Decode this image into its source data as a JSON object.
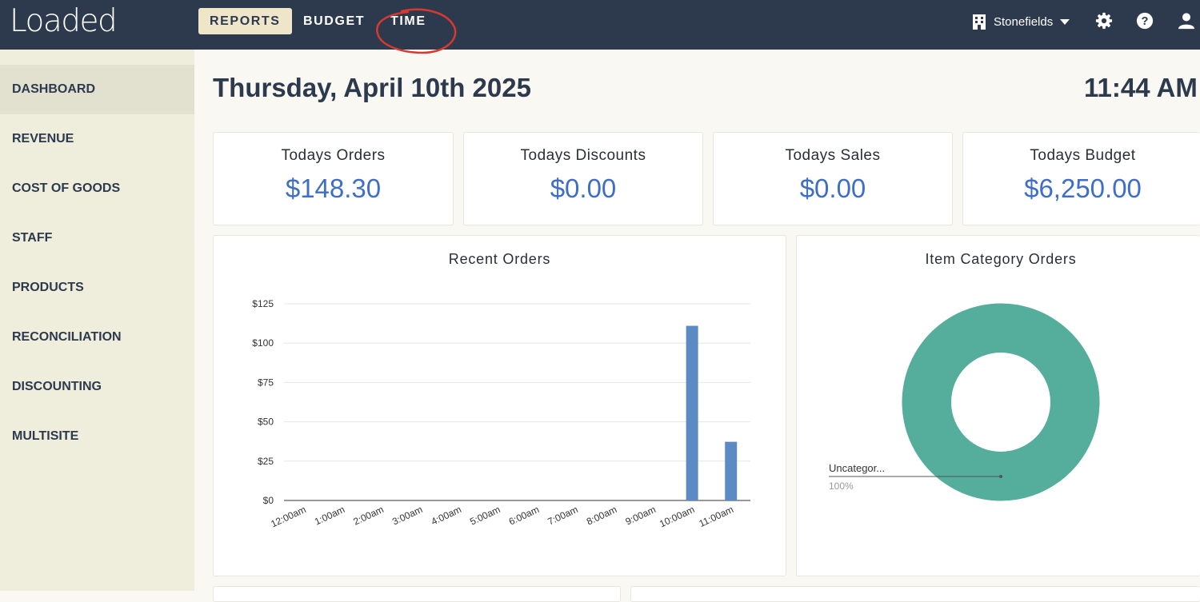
{
  "app": {
    "logo": "Loaded"
  },
  "nav": {
    "tabs": [
      {
        "label": "REPORTS",
        "active": true
      },
      {
        "label": "BUDGET",
        "active": false
      },
      {
        "label": "TIME",
        "active": false
      }
    ],
    "site": "Stonefields"
  },
  "sidebar": {
    "items": [
      {
        "label": "DASHBOARD",
        "active": true
      },
      {
        "label": "REVENUE",
        "active": false
      },
      {
        "label": "COST OF GOODS",
        "active": false
      },
      {
        "label": "STAFF",
        "active": false
      },
      {
        "label": "PRODUCTS",
        "active": false
      },
      {
        "label": "RECONCILIATION",
        "active": false
      },
      {
        "label": "DISCOUNTING",
        "active": false
      },
      {
        "label": "MULTISITE",
        "active": false
      }
    ]
  },
  "header": {
    "date": "Thursday, April 10th 2025",
    "time": "11:44 AM"
  },
  "stats": [
    {
      "title": "Todays Orders",
      "value": "$148.30"
    },
    {
      "title": "Todays Discounts",
      "value": "$0.00"
    },
    {
      "title": "Todays Sales",
      "value": "$0.00"
    },
    {
      "title": "Todays Budget",
      "value": "$6,250.00"
    }
  ],
  "colors": {
    "accent": "#3e6ec7",
    "bar": "#5b8bc2",
    "donut": "#55ad9b",
    "topbar": "#2d3a4e"
  },
  "icons": [
    "building-icon",
    "gear-icon",
    "help-icon",
    "user-icon"
  ],
  "chart_data": [
    {
      "type": "bar",
      "title": "Recent Orders",
      "categories": [
        "12:00am",
        "1:00am",
        "2:00am",
        "3:00am",
        "4:00am",
        "5:00am",
        "6:00am",
        "7:00am",
        "8:00am",
        "9:00am",
        "10:00am",
        "11:00am"
      ],
      "values": [
        0,
        0,
        0,
        0,
        0,
        0,
        0,
        0,
        0,
        0,
        111,
        37.3
      ],
      "ylim": [
        0,
        125
      ],
      "yticks": [
        0,
        25,
        50,
        75,
        100,
        125
      ],
      "ytick_labels": [
        "$0",
        "$25",
        "$50",
        "$75",
        "$100",
        "$125"
      ],
      "grid": true
    },
    {
      "type": "pie",
      "title": "Item Category Orders",
      "slices": [
        {
          "label": "Uncategor...",
          "value": 100,
          "value_label": "100%"
        }
      ]
    }
  ]
}
